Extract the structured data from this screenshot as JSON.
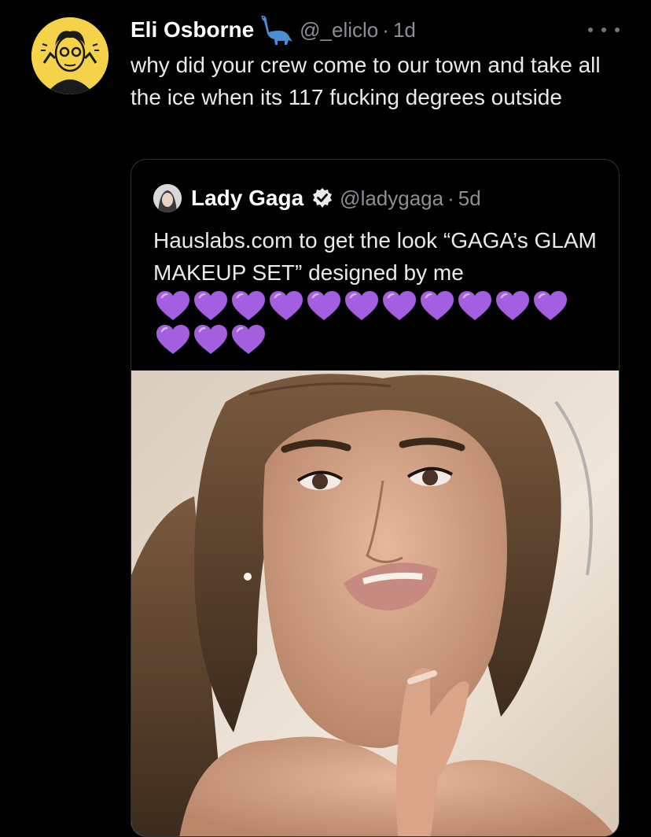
{
  "tweet": {
    "author": {
      "display_name": "Eli Osborne",
      "handle": "@_eliclo",
      "badge_icon": "dinosaur-icon",
      "avatar_icon": "cartoon-avatar-icon"
    },
    "separator": "·",
    "time": "1d",
    "text": "why did your crew come to our town and take all the ice when its 117 fucking degrees outside",
    "more_icon": "more-options-icon"
  },
  "quote": {
    "author": {
      "display_name": "Lady Gaga",
      "handle": "@ladygaga",
      "verified_icon": "verified-badge-icon"
    },
    "separator": "·",
    "time": "5d",
    "text": "Hauslabs.com to get the look  “GAGA’s GLAM MAKEUP SET” designed by me",
    "emoji_icon": "purple-heart-icon",
    "emoji_count": 14,
    "media": "selfie-photo"
  },
  "colors": {
    "background": "#000000",
    "text": "#e7e9ea",
    "muted": "#8b8f94",
    "avatar_bg": "#f4d24a",
    "heart": "#a35fe0",
    "verified": "#e7e9ea",
    "card_border": "#2e3236"
  }
}
